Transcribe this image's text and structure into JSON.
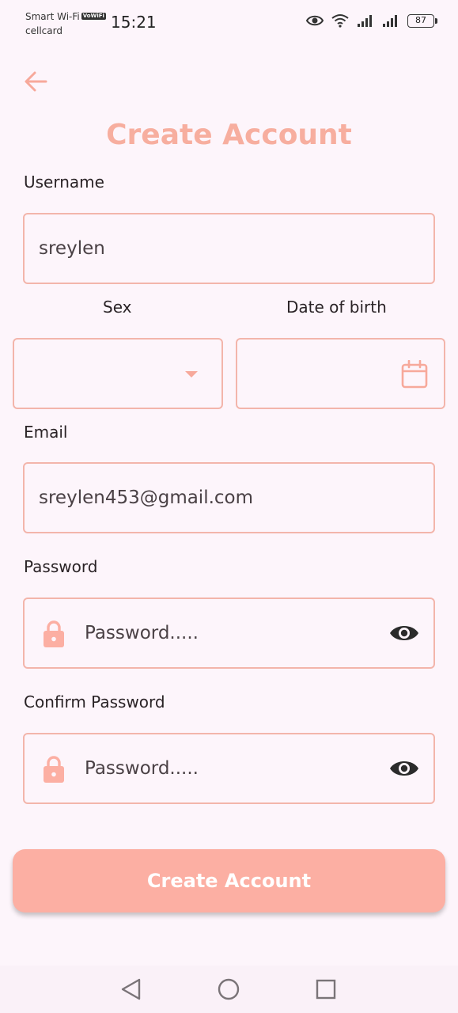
{
  "status_bar": {
    "carrier_line1": "Smart Wi-Fi",
    "vowifi_badge": "VoWiFi",
    "carrier_line2": "cellcard",
    "time": "15:21",
    "battery": "87",
    "icons": [
      "eye-icon",
      "wifi-icon",
      "signal-icon",
      "signal-icon"
    ]
  },
  "header": {
    "back_icon": "arrow-left-icon",
    "title": "Create Account"
  },
  "form": {
    "username": {
      "label": "Username",
      "value": "sreylen"
    },
    "sex": {
      "label": "Sex",
      "value": "",
      "icon": "dropdown-caret-icon"
    },
    "dob": {
      "label": "Date of birth",
      "value": "",
      "icon": "calendar-icon"
    },
    "email": {
      "label": "Email",
      "value": "sreylen453@gmail.com"
    },
    "password": {
      "label": "Password",
      "placeholder": "Password.....",
      "icon": "lock-icon",
      "toggle_icon": "eye-icon"
    },
    "confirm_password": {
      "label": "Confirm Password",
      "placeholder": "Password.....",
      "icon": "lock-icon",
      "toggle_icon": "eye-icon"
    },
    "submit_label": "Create Account"
  },
  "nav_bar": {
    "icons": [
      "back-triangle-icon",
      "home-circle-icon",
      "recents-square-icon"
    ]
  },
  "colors": {
    "accent": "#f7ae9f",
    "field_border": "#f3b5ab",
    "button": "#fcafa3",
    "background": "#fdf5fb"
  }
}
